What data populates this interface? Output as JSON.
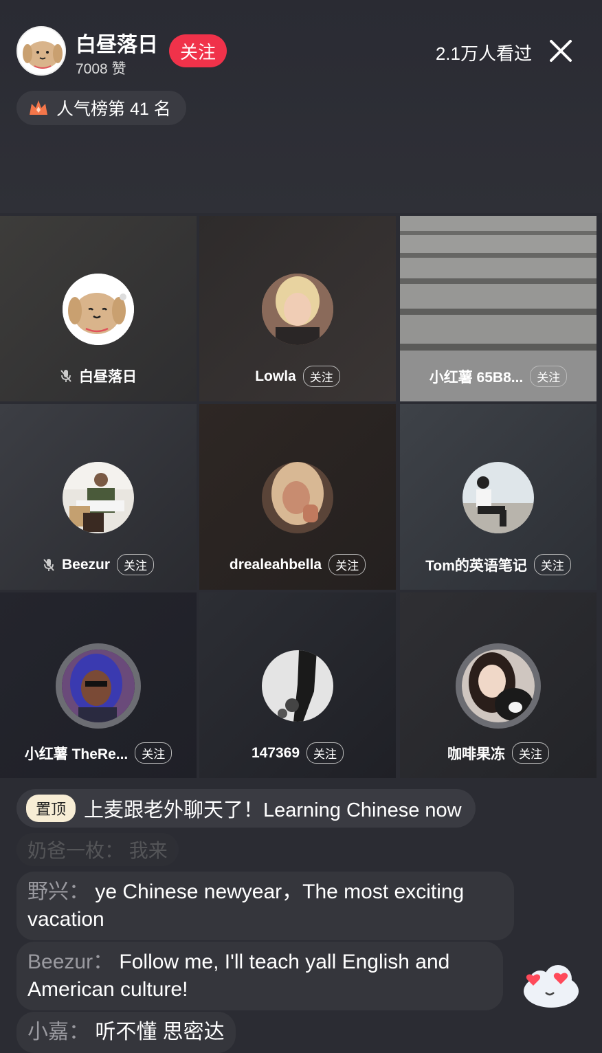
{
  "host": {
    "name": "白昼落日",
    "likes": "7008 赞",
    "follow_label": "关注",
    "viewers": "2.1万人看过",
    "rank": "人气榜第 41 名"
  },
  "grid": [
    {
      "name": "白昼落日",
      "muted": true,
      "follow": ""
    },
    {
      "name": "Lowla",
      "muted": false,
      "follow": "关注"
    },
    {
      "name": "小红薯 65B8...",
      "muted": false,
      "follow": "关注"
    },
    {
      "name": "Beezur",
      "muted": true,
      "follow": "关注"
    },
    {
      "name": "drealeahbella",
      "muted": false,
      "follow": "关注"
    },
    {
      "name": "Tom的英语笔记",
      "muted": false,
      "follow": "关注"
    },
    {
      "name": "小红薯 TheRe...",
      "muted": false,
      "follow": "关注"
    },
    {
      "name": "147369",
      "muted": false,
      "follow": "关注"
    },
    {
      "name": "咖啡果冻",
      "muted": false,
      "follow": "关注"
    }
  ],
  "chat": {
    "pinned_badge": "置顶",
    "pinned_text": "上麦跟老外聊天了！Learning Chinese now",
    "faded": "奶爸一枚：  我来",
    "messages": [
      {
        "user": "野兴：",
        "text": " ye Chinese newyear，The most exciting vacation"
      },
      {
        "user": "Beezur：",
        "text": " Follow me, I'll teach yall English and American culture!"
      },
      {
        "user": "小嘉：",
        "text": " 听不懂 思密达"
      }
    ]
  }
}
